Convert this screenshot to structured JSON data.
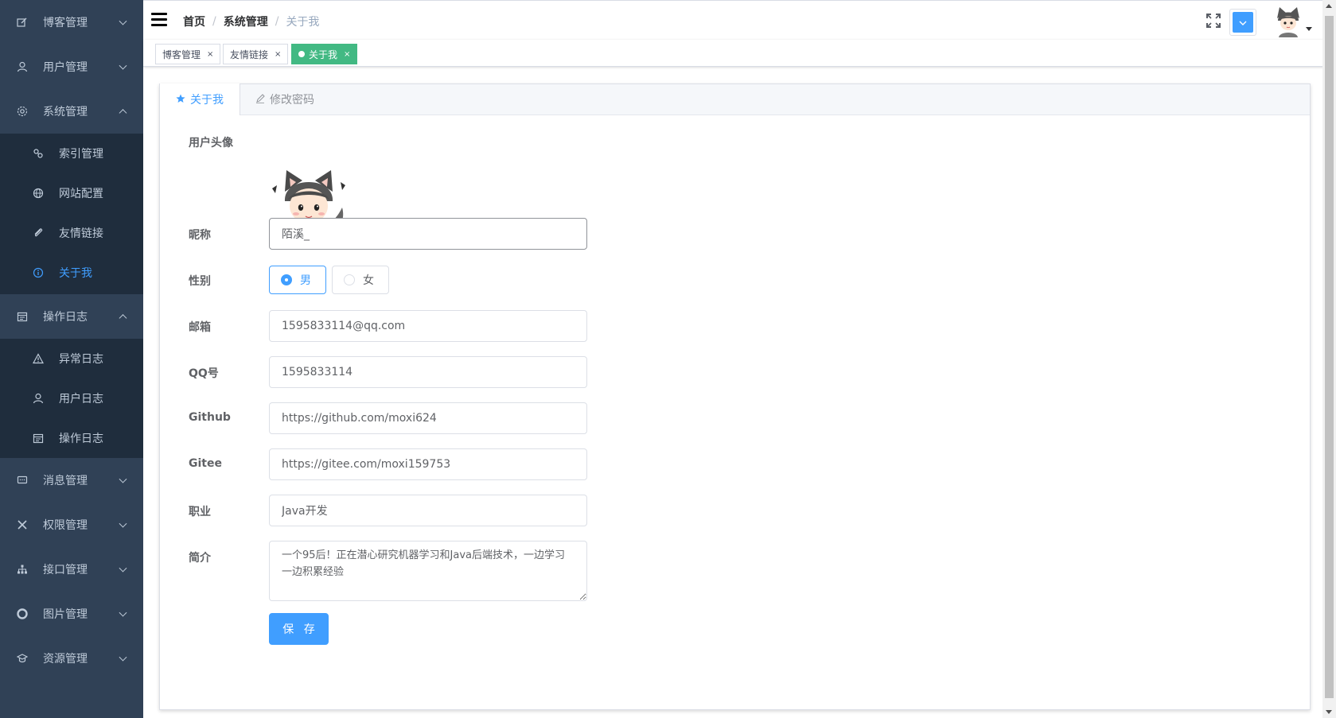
{
  "colors": {
    "sidebar_bg": "#304156",
    "submenu_bg": "#1f2d3d",
    "primary": "#409eff",
    "tag_active": "#42b983"
  },
  "sidebar": {
    "items": [
      {
        "label": "博客管理",
        "icon": "edit-icon",
        "expanded": false
      },
      {
        "label": "用户管理",
        "icon": "user-icon",
        "expanded": false
      },
      {
        "label": "系统管理",
        "icon": "gear-icon",
        "expanded": true,
        "children": [
          {
            "label": "索引管理",
            "icon": "link-icon"
          },
          {
            "label": "网站配置",
            "icon": "globe-icon"
          },
          {
            "label": "友情链接",
            "icon": "paperclip-icon"
          },
          {
            "label": "关于我",
            "icon": "info-icon",
            "active": true
          }
        ]
      },
      {
        "label": "操作日志",
        "icon": "calendar-icon",
        "expanded": true,
        "children": [
          {
            "label": "异常日志",
            "icon": "warning-icon"
          },
          {
            "label": "用户日志",
            "icon": "user-icon"
          },
          {
            "label": "操作日志",
            "icon": "calendar-icon"
          }
        ]
      },
      {
        "label": "消息管理",
        "icon": "message-icon",
        "expanded": false
      },
      {
        "label": "权限管理",
        "icon": "tools-icon",
        "expanded": false
      },
      {
        "label": "接口管理",
        "icon": "sitemap-icon",
        "expanded": false
      },
      {
        "label": "图片管理",
        "icon": "life-ring-icon",
        "expanded": false
      },
      {
        "label": "资源管理",
        "icon": "graduation-cap-icon",
        "expanded": false
      }
    ]
  },
  "navbar": {
    "breadcrumb": [
      "首页",
      "系统管理",
      "关于我"
    ],
    "separator": "/"
  },
  "tags": [
    {
      "label": "博客管理",
      "active": false
    },
    {
      "label": "友情链接",
      "active": false
    },
    {
      "label": "关于我",
      "active": true
    }
  ],
  "tag_close": "×",
  "tabs": [
    {
      "label": "关于我",
      "icon": "star-icon",
      "active": true
    },
    {
      "label": "修改密码",
      "icon": "pencil-icon",
      "active": false
    }
  ],
  "form": {
    "avatar_label": "用户头像",
    "nickname_label": "昵称",
    "nickname": "陌溪_",
    "gender_label": "性别",
    "gender_options": [
      "男",
      "女"
    ],
    "gender_selected": "男",
    "email_label": "邮箱",
    "email": "1595833114@qq.com",
    "qq_label": "QQ号",
    "qq": "1595833114",
    "github_label": "Github",
    "github": "https://github.com/moxi624",
    "gitee_label": "Gitee",
    "gitee": "https://gitee.com/moxi159753",
    "occupation_label": "职业",
    "occupation": "Java开发",
    "summary_label": "简介",
    "summary": "一个95后！正在潜心研究机器学习和Java后端技术，一边学习一边积累经验",
    "save_label": "保 存"
  }
}
